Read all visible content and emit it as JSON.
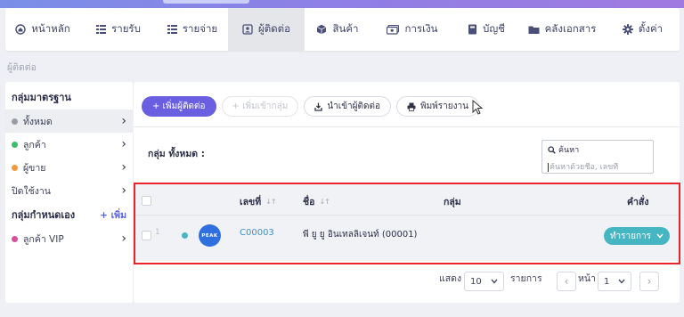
{
  "nav": {
    "items": [
      {
        "label": "หน้าหลัก",
        "icon": "home-icon"
      },
      {
        "label": "รายรับ",
        "icon": "list-icon"
      },
      {
        "label": "รายจ่าย",
        "icon": "list-icon"
      },
      {
        "label": "ผู้ติดต่อ",
        "icon": "contact-card-icon",
        "active": true
      },
      {
        "label": "สินค้า",
        "icon": "box-icon"
      },
      {
        "label": "การเงิน",
        "icon": "money-icon"
      },
      {
        "label": "บัญชี",
        "icon": "book-icon"
      },
      {
        "label": "คลังเอกสาร",
        "icon": "folder-icon"
      },
      {
        "label": "ตั้งค่า",
        "icon": "gear-icon"
      }
    ]
  },
  "breadcrumb": "ผู้ติดต่อ",
  "sidebar": {
    "standard_heading": "กลุ่มมาตรฐาน",
    "standard_items": [
      {
        "label": "ทั้งหมด",
        "dot_color": "#9a9ca3",
        "active": true
      },
      {
        "label": "ลูกค้า",
        "dot_color": "#3cbf6a"
      },
      {
        "label": "ผู้ขาย",
        "dot_color": "#f29a3c"
      },
      {
        "label": "ปิดใช้งาน",
        "dot_color": ""
      }
    ],
    "custom_heading": "กลุ่มกำหนดเอง",
    "custom_add_label": "+ เพิ่ม",
    "custom_items": [
      {
        "label": "ลูกค้า VIP",
        "dot_color": "#d94f9b"
      }
    ]
  },
  "toolbar": {
    "add_contact": "+ เพิ่มผู้ติดต่อ",
    "add_to_group": "+ เพิ่มเข้ากลุ่ม",
    "import_contacts": "นำเข้าผู้ติดต่อ",
    "print_report": "พิมพ์รายงาน"
  },
  "group_label": "กลุ่ม ทั้งหมด :",
  "search": {
    "label": "ค้นหา",
    "placeholder": "ค้นหาด้วยชื่อ, เลขที่"
  },
  "table": {
    "columns": {
      "number": "เลขที่",
      "name": "ชื่อ",
      "group": "กลุ่ม",
      "action": "คำสั่ง"
    },
    "rows": [
      {
        "index": "1",
        "avatar_text": "PEAK",
        "code": "C00003",
        "name": "พี ยู ยู อินเทลลิเจนท์ (00001)",
        "group": "",
        "action_label": "ทำรายการ"
      }
    ]
  },
  "pagination": {
    "show_label": "แสดง",
    "page_size": "10",
    "items_label": "รายการ",
    "page_label": "หน้า",
    "current_page": "1"
  },
  "colors": {
    "accent": "#6a5fe0",
    "action": "#45b6c2",
    "highlight": "#e8232a"
  }
}
